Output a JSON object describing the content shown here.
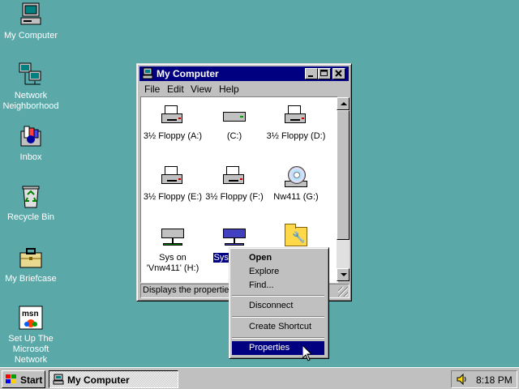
{
  "desktop": {
    "icons": [
      {
        "label": "My Computer",
        "icon": "my-computer-icon"
      },
      {
        "label": "Network Neighborhood",
        "icon": "network-neighborhood-icon"
      },
      {
        "label": "Inbox",
        "icon": "inbox-icon"
      },
      {
        "label": "Recycle Bin",
        "icon": "recycle-bin-icon"
      },
      {
        "label": "My Briefcase",
        "icon": "briefcase-icon"
      },
      {
        "label": "Set Up The Microsoft Network",
        "icon": "msn-icon"
      }
    ]
  },
  "window": {
    "title": "My Computer",
    "menu": [
      "File",
      "Edit",
      "View",
      "Help"
    ],
    "items": [
      {
        "label": "3½ Floppy (A:)",
        "icon": "floppy-drive-icon"
      },
      {
        "label": "(C:)",
        "icon": "hard-drive-icon"
      },
      {
        "label": "3½ Floppy (D:)",
        "icon": "floppy-drive-icon"
      },
      {
        "label": "3½ Floppy (E:)",
        "icon": "floppy-drive-icon"
      },
      {
        "label": "3½ Floppy (F:)",
        "icon": "floppy-drive-icon"
      },
      {
        "label": "Nw411 (G:)",
        "icon": "cd-drive-icon"
      },
      {
        "label": "Sys on 'Vnw411' (H:)",
        "icon": "network-drive-icon"
      },
      {
        "label": "Sys 'Vnw4",
        "icon": "network-drive-icon"
      },
      {
        "label": "",
        "icon": "control-panel-folder-icon"
      }
    ],
    "status": "Displays the properties"
  },
  "context_menu": {
    "items": [
      "Open",
      "Explore",
      "Find...",
      "Disconnect",
      "Create Shortcut",
      "Properties"
    ],
    "default_item": "Open",
    "highlighted_item": "Properties"
  },
  "taskbar": {
    "start_label": "Start",
    "task_label": "My Computer",
    "clock": "8:18 PM"
  },
  "colors": {
    "desktop": "#5aa8a8",
    "title_bar": "#000080",
    "face": "#c0c0c0"
  }
}
